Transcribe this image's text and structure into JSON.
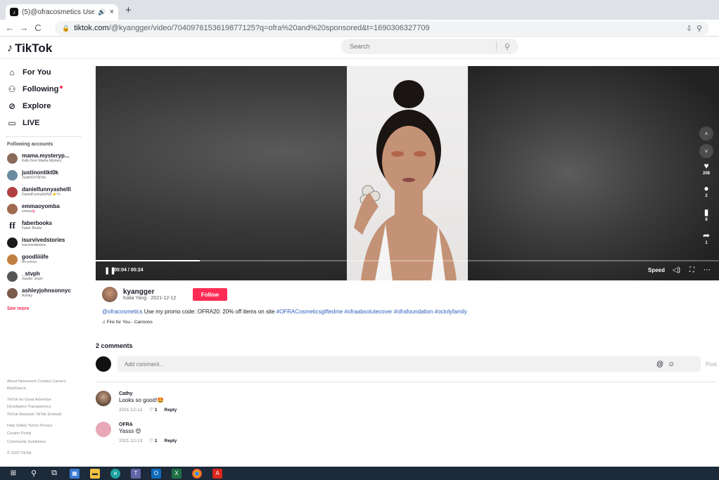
{
  "browser": {
    "tab_title": "(5)@ofracosmetics Use my p",
    "tab_audio_icon": "speaker-icon",
    "new_tab_label": "+",
    "url_host": "tiktok.com",
    "url_path": "/@kyangger/video/7040976153619877125?q=ofra%20and%20sponsored&t=1690306327709"
  },
  "header": {
    "logo_text": "TikTok",
    "search_placeholder": "Search"
  },
  "sidebar": {
    "nav": [
      {
        "label": "For You",
        "icon": "home-icon"
      },
      {
        "label": "Following",
        "icon": "people-icon"
      },
      {
        "label": "Explore",
        "icon": "compass-icon"
      },
      {
        "label": "LIVE",
        "icon": "live-icon"
      }
    ],
    "following_label": "Following accounts",
    "accounts": [
      {
        "name": "mama.mysteryp...",
        "sub": "Kelly from Mama Mystery",
        "color": "#8a6a5a"
      },
      {
        "name": "justinontikt0k",
        "sub": "JustinOnTikTok",
        "color": "#6a8aa0"
      },
      {
        "name": "danielfunnyashelll",
        "sub": "DanielFunnyAsHell 👉H...",
        "color": "#b04040"
      },
      {
        "name": "emmaoyomba",
        "sub": "emma🌸",
        "color": "#a06a50"
      },
      {
        "name": "faberbooks",
        "sub": "Faber Books",
        "color": "#ffffff"
      },
      {
        "name": "isurvivedstories",
        "sub": "isurvivedstories",
        "color": "#1a1a1a"
      },
      {
        "name": "goodliiiife",
        "sub": "Be-yonce",
        "color": "#c08040"
      },
      {
        "name": "_stvph",
        "sub": "maybe: stvph",
        "color": "#555555"
      },
      {
        "name": "ashleyjohnsonnyc",
        "sub": "Ashley",
        "color": "#7a5a4a"
      }
    ],
    "see_more": "See more",
    "footer": [
      "About  Newsroom  Contact  Careers",
      "ByteDance",
      "TikTok for Good  Advertise",
      "Developers  Transparency",
      "TikTok Rewards  TikTok Embeds",
      "Help  Safety  Terms  Privacy",
      "Creator Portal",
      "Community Guidelines",
      "© 2023 TikTok"
    ]
  },
  "video": {
    "time": "00:04 / 00:24",
    "progress": 0.167,
    "speed_label": "Speed",
    "stats": {
      "likes": "208",
      "comments": "2",
      "saves": "8",
      "shares": "1"
    }
  },
  "post": {
    "author": "kyangger",
    "author_sub": "Kalia Yang · 2021-12-12",
    "follow_label": "Follow",
    "desc_mention": "@ofracosmetics",
    "desc_text": " Use my promo code: OFRA20: 20% off items on site ",
    "desc_tags": "#OFRACosmeticsgiftedme #ofraabsolutecover #ofrafoundation #octolyfamily",
    "music": "Fire for You - Cannons"
  },
  "comments": {
    "count_label": "2 comments",
    "placeholder": "Add comment...",
    "post_label": "Post",
    "items": [
      {
        "name": "Cathy",
        "text": "Looks so good!🤩",
        "date": "2021-12-13",
        "likes": "1",
        "reply": "Reply",
        "color": "#5a3a2a"
      },
      {
        "name": "OFRA",
        "text": "Yasss 😍",
        "date": "2021-12-13",
        "likes": "1",
        "reply": "Reply",
        "color": "#e8a8b8"
      }
    ]
  },
  "taskbar": {
    "icons": [
      "windows-start-icon",
      "search-icon",
      "task-view-icon",
      "widgets-icon",
      "file-explorer-icon",
      "edge-icon",
      "teams-icon",
      "outlook-icon",
      "excel-icon",
      "chrome-icon",
      "acrobat-icon"
    ]
  }
}
